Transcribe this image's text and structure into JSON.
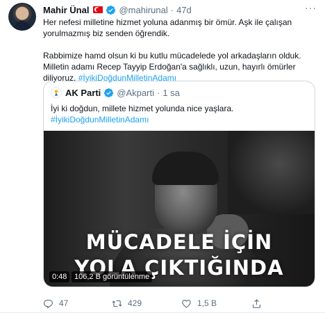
{
  "tweet": {
    "author_name": "Mahir Ünal",
    "handle": "@mahirunal",
    "separator": "·",
    "time": "47d",
    "more_label": "···",
    "paragraph1_line1": "Her nefesi milletine hizmet yoluna adanmış bir ömür. Aşk ile çalışan",
    "paragraph1_line2": "yorulmazmış biz senden öğrendik.",
    "paragraph2_line1": "Rabbimize hamd olsun ki bu kutlu mücadelede yol arkadaşların olduk.",
    "paragraph2_line2": "Milletin adamı Recep Tayyip Erdoğan'a sağlıklı, uzun, hayırlı ömürler",
    "paragraph2_line3_text": "diliyoruz. ",
    "paragraph2_hashtag": "#İyikiDoğdunMilletinAdamı",
    "icons": {
      "avatar": "avatar",
      "flag": "turkey-flag-icon",
      "verified": "verified-badge-icon"
    }
  },
  "quote": {
    "author_name": "AK Parti",
    "handle": "@Akparti",
    "separator": "·",
    "time": "1 sa",
    "line1": "İyi ki doğdun, millete hizmet yolunda nice yaşlara.",
    "line2": "#İyikiDoğdunMilletinAdamı",
    "video": {
      "caption_line1": "MÜCADELE İÇİN",
      "caption_line2": "YOLA ÇIKTIĞINDA",
      "duration": "0:48",
      "views": "106,2 B görüntülenme"
    }
  },
  "actions": {
    "replies": "47",
    "retweets": "429",
    "likes": "1,5 B"
  },
  "colors": {
    "accent": "#1da1f2",
    "secondary_text": "#5b7083",
    "verified": "#1da1f2",
    "flag_red": "#e30a17"
  }
}
